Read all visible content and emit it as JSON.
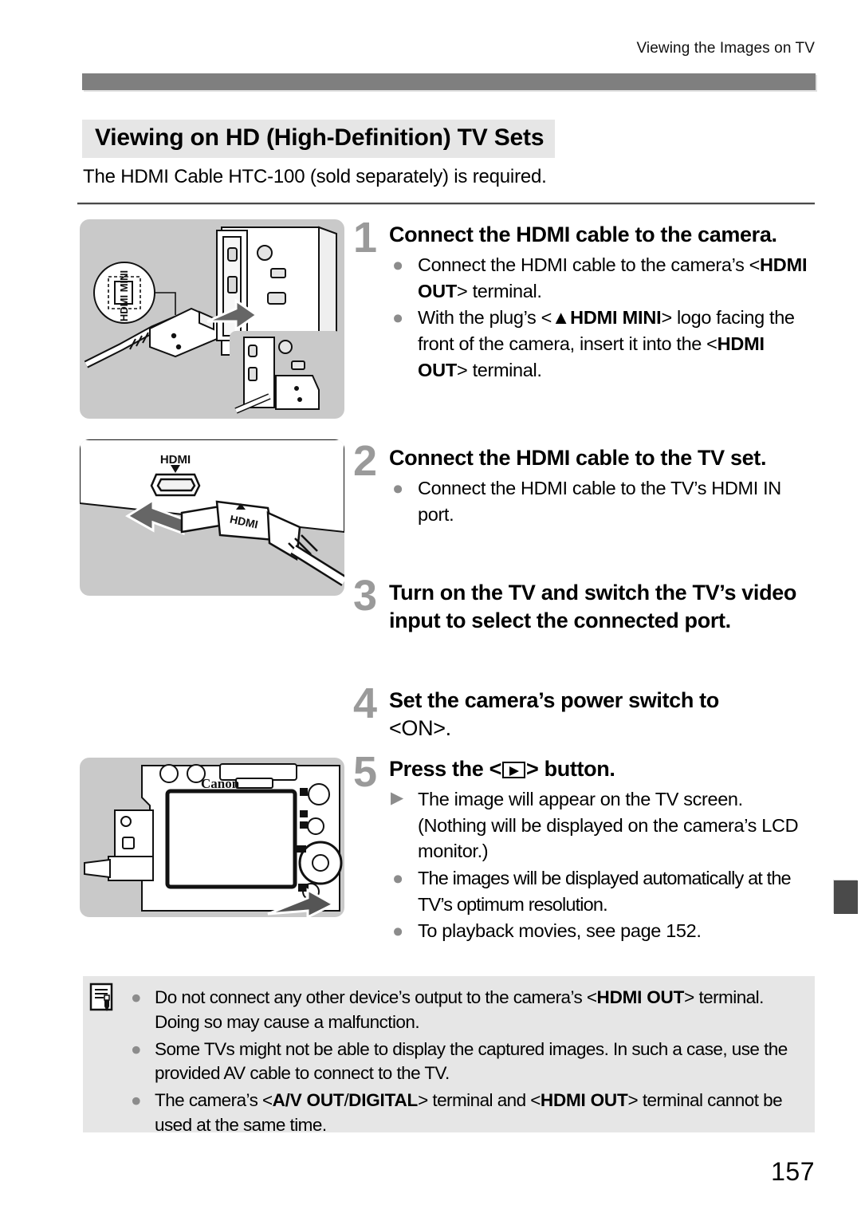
{
  "header": {
    "running_title": "Viewing the Images on TV"
  },
  "section": {
    "heading": "Viewing on HD (High-Definition) TV Sets",
    "intro": "The HDMI Cable HTC-100 (sold separately) is required."
  },
  "steps": [
    {
      "number": "1",
      "title": "Connect the HDMI cable to the camera.",
      "bullets": [
        {
          "marker": "dot",
          "segments": [
            {
              "text": "Connect the HDMI cable to the camera’s <",
              "bold": false
            },
            {
              "text": "HDMI OUT",
              "bold": true
            },
            {
              "text": "> terminal.",
              "bold": false
            }
          ]
        },
        {
          "marker": "dot",
          "segments": [
            {
              "text": "With the plug’s <▲",
              "bold": false
            },
            {
              "text": "HDMI MINI",
              "bold": true
            },
            {
              "text": "> logo facing the front of the camera, insert it into the <",
              "bold": false
            },
            {
              "text": "HDMI OUT",
              "bold": true
            },
            {
              "text": "> terminal.",
              "bold": false
            }
          ]
        }
      ]
    },
    {
      "number": "2",
      "title": "Connect the HDMI cable to the TV set.",
      "bullets": [
        {
          "marker": "dot",
          "segments": [
            {
              "text": "Connect the HDMI cable to the TV’s HDMI IN port.",
              "bold": false
            }
          ]
        }
      ]
    },
    {
      "number": "3",
      "title": "Turn on the TV and switch the TV’s video input to select the connected port.",
      "bullets": []
    },
    {
      "number": "4",
      "title": "Set the camera’s power switch to <ON>.",
      "bullets": []
    },
    {
      "number": "5",
      "title": "Press the <▶> button.",
      "bullets": [
        {
          "marker": "triangle",
          "segments": [
            {
              "text": "The image will appear on the TV screen. (Nothing will be displayed on the camera’s LCD monitor.)",
              "bold": false
            }
          ]
        },
        {
          "marker": "dot",
          "tight": true,
          "segments": [
            {
              "text": "The images will be displayed automatically at the TV’s optimum resolution.",
              "bold": false
            }
          ]
        },
        {
          "marker": "dot",
          "segments": [
            {
              "text": "To playback movies, see page 152.",
              "bold": false
            }
          ]
        }
      ]
    }
  ],
  "note_box": {
    "icon": "note-pencil-icon",
    "items": [
      {
        "segments": [
          {
            "text": "Do not connect any other device’s output to the camera’s <",
            "bold": false
          },
          {
            "text": "HDMI OUT",
            "bold": true
          },
          {
            "text": "> terminal. Doing so may cause a malfunction.",
            "bold": false
          }
        ]
      },
      {
        "segments": [
          {
            "text": "Some TVs might not be able to display the captured images. In such a case, use the provided AV cable to connect to the TV.",
            "bold": false
          }
        ]
      },
      {
        "segments": [
          {
            "text": "The camera’s <",
            "bold": false
          },
          {
            "text": "A/V OUT",
            "bold": true
          },
          {
            "text": "/",
            "bold": false
          },
          {
            "text": "DIGITAL",
            "bold": true
          },
          {
            "text": "> terminal and <",
            "bold": false
          },
          {
            "text": "HDMI OUT",
            "bold": true
          },
          {
            "text": "> terminal cannot be used at the same time.",
            "bold": false
          }
        ]
      }
    ]
  },
  "figures": [
    {
      "name": "hdmi-cable-to-camera-illustration",
      "labels": [
        "HDMI MINI"
      ],
      "caption": "HDMI mini plug being inserted into the camera's HDMI OUT terminal"
    },
    {
      "name": "hdmi-cable-to-tv-illustration",
      "labels": [
        "HDMI"
      ],
      "caption": "HDMI plug being inserted into a TV's HDMI IN port"
    },
    {
      "name": "camera-rear-playback-button-illustration",
      "labels": [
        "Canon"
      ],
      "caption": "Rear of the camera with the playback button highlighted"
    }
  ],
  "page_number": "157",
  "colors": {
    "header_bar": "#7f7f7f",
    "heading_band": "#e6e6e6",
    "note_box": "#e6e6e6",
    "step_number": "#9a9a9a",
    "bullet": "#8c8c8c",
    "edge_tab": "#4a4a4a",
    "figure_bg": "#c9c9c9"
  }
}
